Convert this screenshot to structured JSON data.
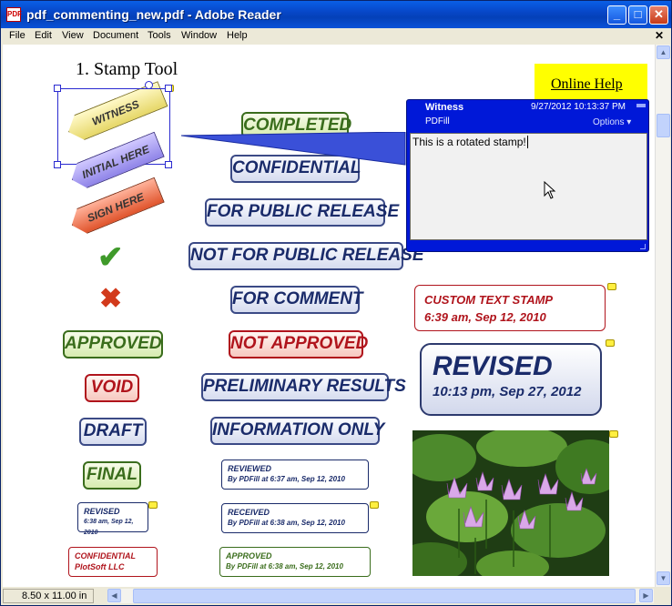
{
  "window": {
    "title": "pdf_commenting_new.pdf - Adobe Reader",
    "app_icon_label": "PDF"
  },
  "menubar": [
    "File",
    "Edit",
    "View",
    "Document",
    "Tools",
    "Window",
    "Help"
  ],
  "document": {
    "heading": "1. Stamp Tool",
    "help_link": "Online Help",
    "arrow_stamps": [
      "WITNESS",
      "INITIAL HERE",
      "SIGN HERE"
    ],
    "left_stamps": [
      "APPROVED",
      "VOID",
      "DRAFT",
      "FINAL"
    ],
    "center_stamps": [
      "COMPLETED",
      "CONFIDENTIAL",
      "FOR PUBLIC RELEASE",
      "NOT FOR PUBLIC RELEASE",
      "FOR COMMENT",
      "NOT APPROVED",
      "PRELIMINARY RESULTS",
      "INFORMATION ONLY"
    ],
    "small_left": [
      {
        "line1": "REVISED",
        "line2": "6:38 am, Sep 12, 2010"
      },
      {
        "line1": "CONFIDENTIAL",
        "line2": "PlotSoft LLC"
      }
    ],
    "small_center": [
      {
        "line1": "REVIEWED",
        "line2": "By PDFill at 6:37 am, Sep 12, 2010"
      },
      {
        "line1": "RECEIVED",
        "line2": "By PDFill at 6:38 am, Sep 12, 2010"
      },
      {
        "line1": "APPROVED",
        "line2": "By PDFill at 6:38 am, Sep 12, 2010"
      }
    ],
    "custom_stamp": {
      "line1": "CUSTOM TEXT STAMP",
      "line2": "6:39 am, Sep 12, 2010"
    },
    "revised_stamp": {
      "line1": "REVISED",
      "line2": "10:13 pm, Sep 27, 2012"
    }
  },
  "popup": {
    "author": "Witness",
    "date": "9/27/2012 10:13:37 PM",
    "subject": "PDFill",
    "options": "Options",
    "text": "This is a rotated stamp!"
  },
  "status": {
    "page_size": "8.50 x 11.00 in"
  },
  "colors": {
    "titlebar": "#0a52d8",
    "help_bg": "#ffff00",
    "popup": "#0018d8"
  }
}
